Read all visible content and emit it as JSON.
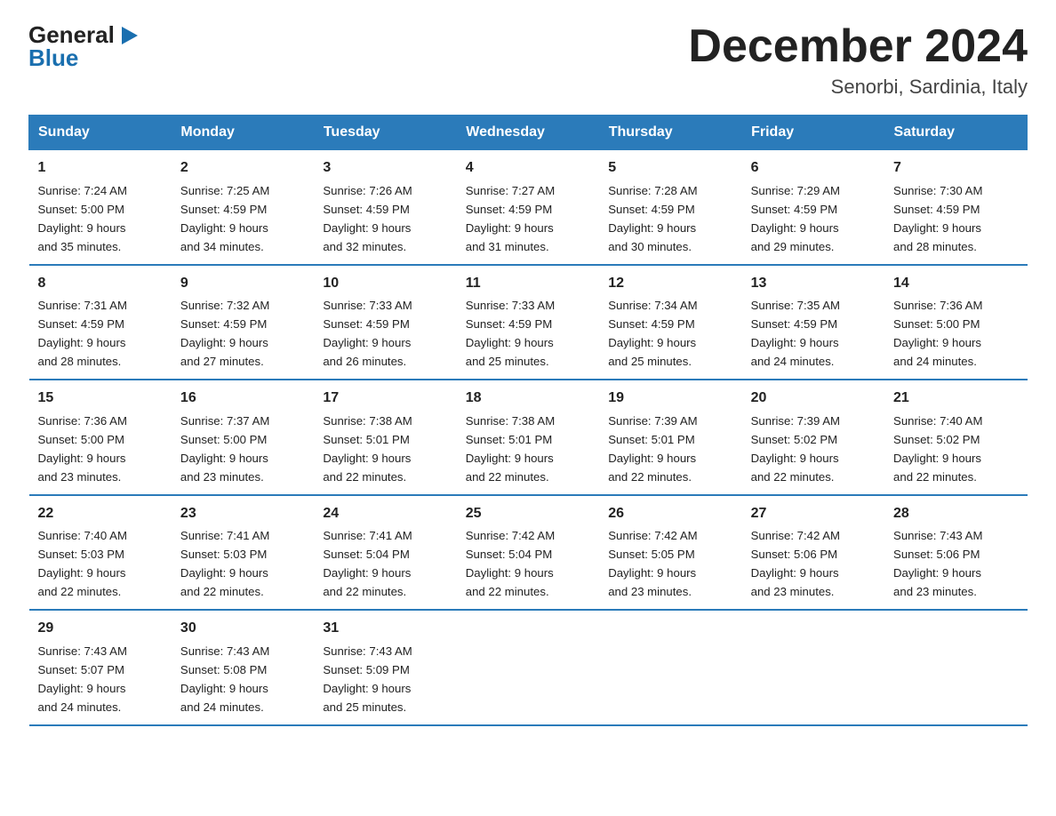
{
  "logo": {
    "line1": "General",
    "triangle": "▶",
    "line2": "Blue"
  },
  "title": "December 2024",
  "subtitle": "Senorbi, Sardinia, Italy",
  "days_of_week": [
    "Sunday",
    "Monday",
    "Tuesday",
    "Wednesday",
    "Thursday",
    "Friday",
    "Saturday"
  ],
  "weeks": [
    [
      {
        "day": "1",
        "sunrise": "7:24 AM",
        "sunset": "5:00 PM",
        "daylight": "9 hours and 35 minutes."
      },
      {
        "day": "2",
        "sunrise": "7:25 AM",
        "sunset": "4:59 PM",
        "daylight": "9 hours and 34 minutes."
      },
      {
        "day": "3",
        "sunrise": "7:26 AM",
        "sunset": "4:59 PM",
        "daylight": "9 hours and 32 minutes."
      },
      {
        "day": "4",
        "sunrise": "7:27 AM",
        "sunset": "4:59 PM",
        "daylight": "9 hours and 31 minutes."
      },
      {
        "day": "5",
        "sunrise": "7:28 AM",
        "sunset": "4:59 PM",
        "daylight": "9 hours and 30 minutes."
      },
      {
        "day": "6",
        "sunrise": "7:29 AM",
        "sunset": "4:59 PM",
        "daylight": "9 hours and 29 minutes."
      },
      {
        "day": "7",
        "sunrise": "7:30 AM",
        "sunset": "4:59 PM",
        "daylight": "9 hours and 28 minutes."
      }
    ],
    [
      {
        "day": "8",
        "sunrise": "7:31 AM",
        "sunset": "4:59 PM",
        "daylight": "9 hours and 28 minutes."
      },
      {
        "day": "9",
        "sunrise": "7:32 AM",
        "sunset": "4:59 PM",
        "daylight": "9 hours and 27 minutes."
      },
      {
        "day": "10",
        "sunrise": "7:33 AM",
        "sunset": "4:59 PM",
        "daylight": "9 hours and 26 minutes."
      },
      {
        "day": "11",
        "sunrise": "7:33 AM",
        "sunset": "4:59 PM",
        "daylight": "9 hours and 25 minutes."
      },
      {
        "day": "12",
        "sunrise": "7:34 AM",
        "sunset": "4:59 PM",
        "daylight": "9 hours and 25 minutes."
      },
      {
        "day": "13",
        "sunrise": "7:35 AM",
        "sunset": "4:59 PM",
        "daylight": "9 hours and 24 minutes."
      },
      {
        "day": "14",
        "sunrise": "7:36 AM",
        "sunset": "5:00 PM",
        "daylight": "9 hours and 24 minutes."
      }
    ],
    [
      {
        "day": "15",
        "sunrise": "7:36 AM",
        "sunset": "5:00 PM",
        "daylight": "9 hours and 23 minutes."
      },
      {
        "day": "16",
        "sunrise": "7:37 AM",
        "sunset": "5:00 PM",
        "daylight": "9 hours and 23 minutes."
      },
      {
        "day": "17",
        "sunrise": "7:38 AM",
        "sunset": "5:01 PM",
        "daylight": "9 hours and 22 minutes."
      },
      {
        "day": "18",
        "sunrise": "7:38 AM",
        "sunset": "5:01 PM",
        "daylight": "9 hours and 22 minutes."
      },
      {
        "day": "19",
        "sunrise": "7:39 AM",
        "sunset": "5:01 PM",
        "daylight": "9 hours and 22 minutes."
      },
      {
        "day": "20",
        "sunrise": "7:39 AM",
        "sunset": "5:02 PM",
        "daylight": "9 hours and 22 minutes."
      },
      {
        "day": "21",
        "sunrise": "7:40 AM",
        "sunset": "5:02 PM",
        "daylight": "9 hours and 22 minutes."
      }
    ],
    [
      {
        "day": "22",
        "sunrise": "7:40 AM",
        "sunset": "5:03 PM",
        "daylight": "9 hours and 22 minutes."
      },
      {
        "day": "23",
        "sunrise": "7:41 AM",
        "sunset": "5:03 PM",
        "daylight": "9 hours and 22 minutes."
      },
      {
        "day": "24",
        "sunrise": "7:41 AM",
        "sunset": "5:04 PM",
        "daylight": "9 hours and 22 minutes."
      },
      {
        "day": "25",
        "sunrise": "7:42 AM",
        "sunset": "5:04 PM",
        "daylight": "9 hours and 22 minutes."
      },
      {
        "day": "26",
        "sunrise": "7:42 AM",
        "sunset": "5:05 PM",
        "daylight": "9 hours and 23 minutes."
      },
      {
        "day": "27",
        "sunrise": "7:42 AM",
        "sunset": "5:06 PM",
        "daylight": "9 hours and 23 minutes."
      },
      {
        "day": "28",
        "sunrise": "7:43 AM",
        "sunset": "5:06 PM",
        "daylight": "9 hours and 23 minutes."
      }
    ],
    [
      {
        "day": "29",
        "sunrise": "7:43 AM",
        "sunset": "5:07 PM",
        "daylight": "9 hours and 24 minutes."
      },
      {
        "day": "30",
        "sunrise": "7:43 AM",
        "sunset": "5:08 PM",
        "daylight": "9 hours and 24 minutes."
      },
      {
        "day": "31",
        "sunrise": "7:43 AM",
        "sunset": "5:09 PM",
        "daylight": "9 hours and 25 minutes."
      },
      null,
      null,
      null,
      null
    ]
  ],
  "labels": {
    "sunrise": "Sunrise:",
    "sunset": "Sunset:",
    "daylight": "Daylight:"
  },
  "colors": {
    "header_bg": "#2b7bba",
    "border": "#2b7bba",
    "logo_blue": "#1a6faf"
  }
}
